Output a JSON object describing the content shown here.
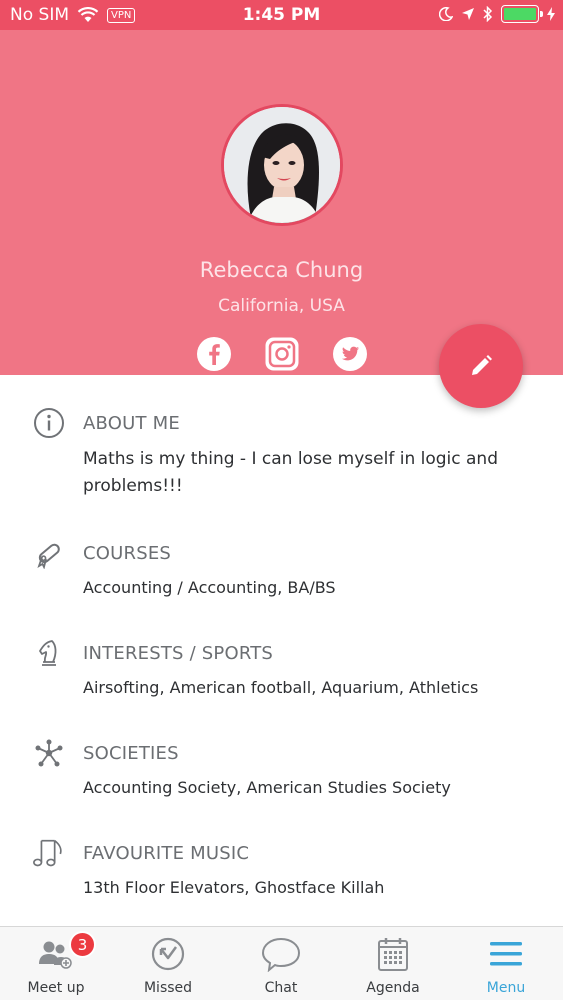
{
  "status_bar": {
    "carrier": "No SIM",
    "vpn": "VPN",
    "time": "1:45 PM",
    "battery_level": 1.0
  },
  "profile": {
    "name": "Rebecca Chung",
    "location": "California, USA"
  },
  "social": [
    {
      "icon": "facebook-icon"
    },
    {
      "icon": "instagram-icon"
    },
    {
      "icon": "twitter-icon"
    }
  ],
  "sections": {
    "about": {
      "title": "ABOUT ME",
      "text": "Maths is my thing - I can lose myself in logic and problems!!!"
    },
    "courses": {
      "title": "COURSES",
      "text": "Accounting / Accounting, BA/BS"
    },
    "interests": {
      "title": "INTERESTS / SPORTS",
      "text": "Airsofting, American football, Aquarium, Athletics"
    },
    "societies": {
      "title": "SOCIETIES",
      "text": "Accounting Society, American Studies Society"
    },
    "music": {
      "title": "FAVOURITE MUSIC",
      "text": "13th Floor Elevators, Ghostface Killah"
    }
  },
  "tabs": [
    {
      "label": "Meet up",
      "icon": "people-icon",
      "badge": "3"
    },
    {
      "label": "Missed",
      "icon": "missed-icon"
    },
    {
      "label": "Chat",
      "icon": "chat-bubble-icon"
    },
    {
      "label": "Agenda",
      "icon": "calendar-icon"
    },
    {
      "label": "Menu",
      "icon": "hamburger-menu-icon",
      "active": true
    }
  ],
  "colors": {
    "header": "#f07585",
    "accent": "#ec4f64",
    "active_tab": "#3aa5d8",
    "badge": "#ec3a40"
  }
}
